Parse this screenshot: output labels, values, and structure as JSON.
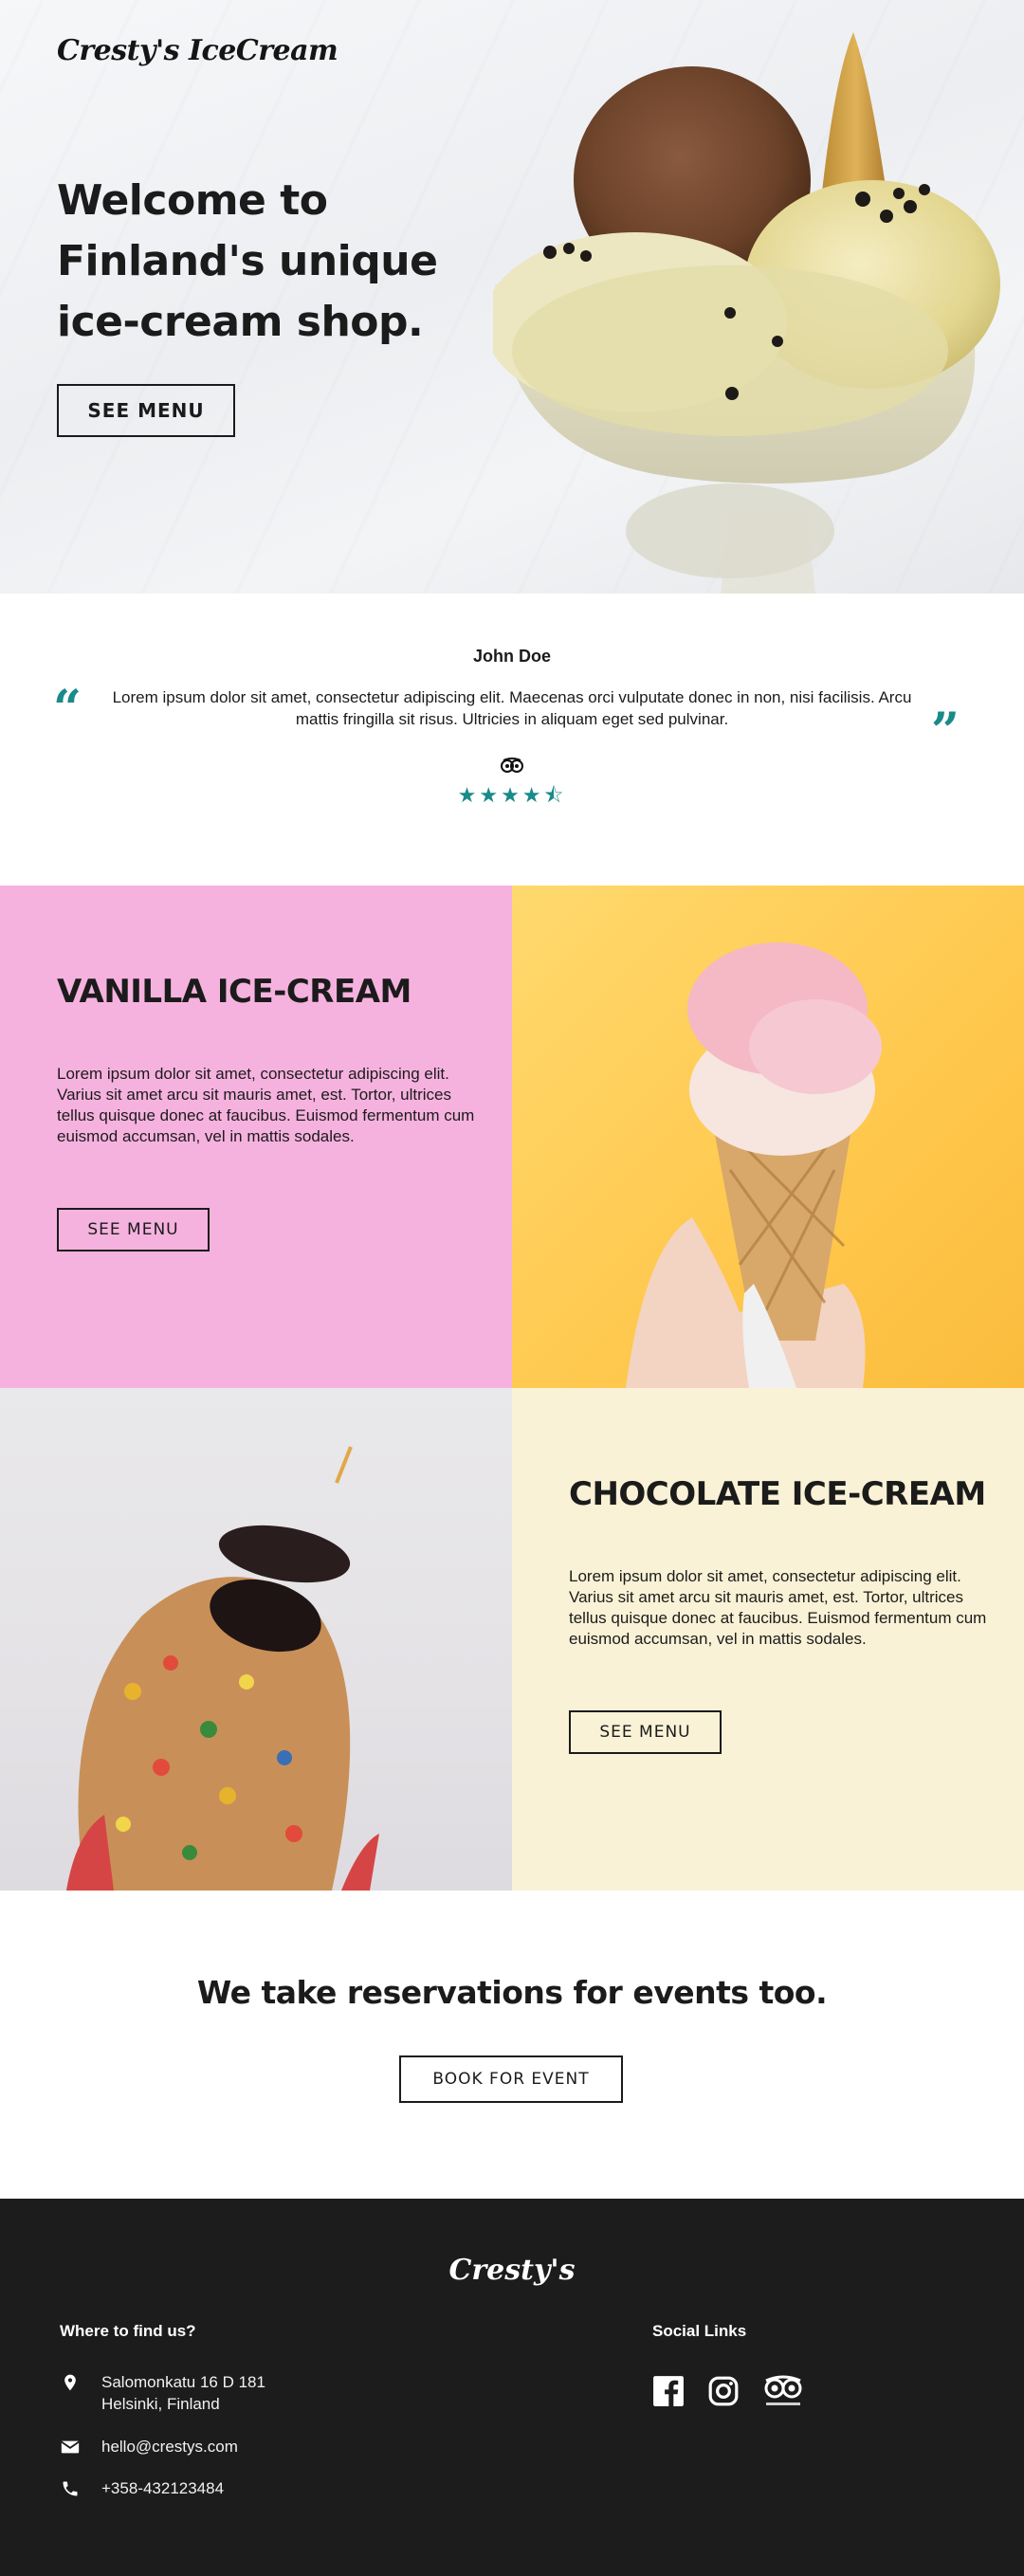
{
  "brand": {
    "logo": "Cresty's IceCream",
    "footer_logo": "Cresty's"
  },
  "hero": {
    "headline": "Welcome to Finland's unique ice-cream shop.",
    "cta": "SEE MENU"
  },
  "review": {
    "reviewer": "John Doe",
    "text": "Lorem ipsum dolor sit amet, consectetur adipiscing elit. Maecenas orci vulputate donec in non, nisi facilisis. Arcu mattis fringilla sit risus. Ultricies in aliquam eget sed pulvinar.",
    "rating": 4.5,
    "stars": "★★★★⯪",
    "source_icon": "tripadvisor-icon"
  },
  "products": [
    {
      "title": "VANILLA ICE-CREAM",
      "description": "Lorem ipsum dolor sit amet, consectetur adipiscing elit. Varius sit amet arcu sit mauris amet, est. Tortor, ultrices tellus quisque donec at faucibus. Euismod fermentum cum euismod accumsan, vel in mattis sodales.",
      "cta": "SEE MENU",
      "bg": "#f6b2df"
    },
    {
      "title": "CHOCOLATE ICE-CREAM",
      "description": "Lorem ipsum dolor sit amet, consectetur adipiscing elit. Varius sit amet arcu sit mauris amet, est. Tortor, ultrices tellus quisque donec at faucibus. Euismod fermentum cum euismod accumsan, vel in mattis sodales.",
      "cta": "SEE MENU",
      "bg": "#faf2d6"
    }
  ],
  "events": {
    "heading": "We take reservations for events too.",
    "cta": "BOOK FOR EVENT"
  },
  "footer": {
    "find_us_heading": "Where to find us?",
    "address_line1": "Salomonkatu 16 D 181",
    "address_line2": "Helsinki, Finland",
    "email": "hello@crestys.com",
    "phone": "+358-432123484",
    "social_heading": "Social Links",
    "social": [
      "facebook-icon",
      "instagram-icon",
      "tripadvisor-icon"
    ]
  },
  "colors": {
    "accent": "#1a8a8a",
    "footer_bg": "#1c1c1c",
    "text": "#1b1b1b"
  }
}
